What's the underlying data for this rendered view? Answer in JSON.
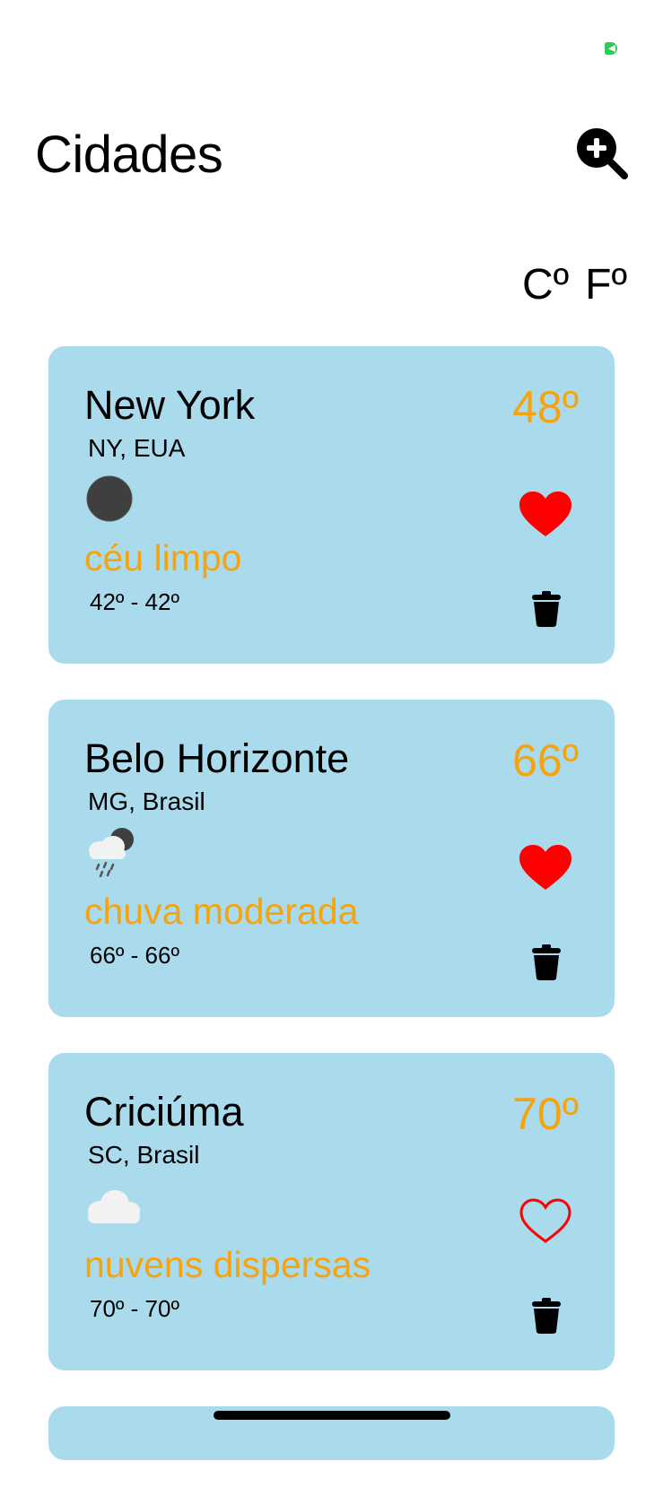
{
  "header": {
    "title": "Cidades",
    "add_icon": "zoom-in-icon"
  },
  "units": {
    "celsius": "Cº",
    "fahrenheit": "Fº"
  },
  "colors": {
    "card_background": "#a9dbed",
    "accent": "#f5a30f",
    "heart": "#ff0000"
  },
  "cities": [
    {
      "name": "New York",
      "region": "NY, EUA",
      "temperature": "48º",
      "icon": "moon-icon",
      "description": "céu limpo",
      "range": "42º - 42º",
      "favorite": true
    },
    {
      "name": "Belo Horizonte",
      "region": "MG, Brasil",
      "temperature": "66º",
      "icon": "night-rain-icon",
      "description": "chuva moderada",
      "range": "66º - 66º",
      "favorite": true
    },
    {
      "name": "Criciúma",
      "region": "SC, Brasil",
      "temperature": "70º",
      "icon": "cloud-icon",
      "description": "nuvens dispersas",
      "range": "70º - 70º",
      "favorite": false
    }
  ]
}
